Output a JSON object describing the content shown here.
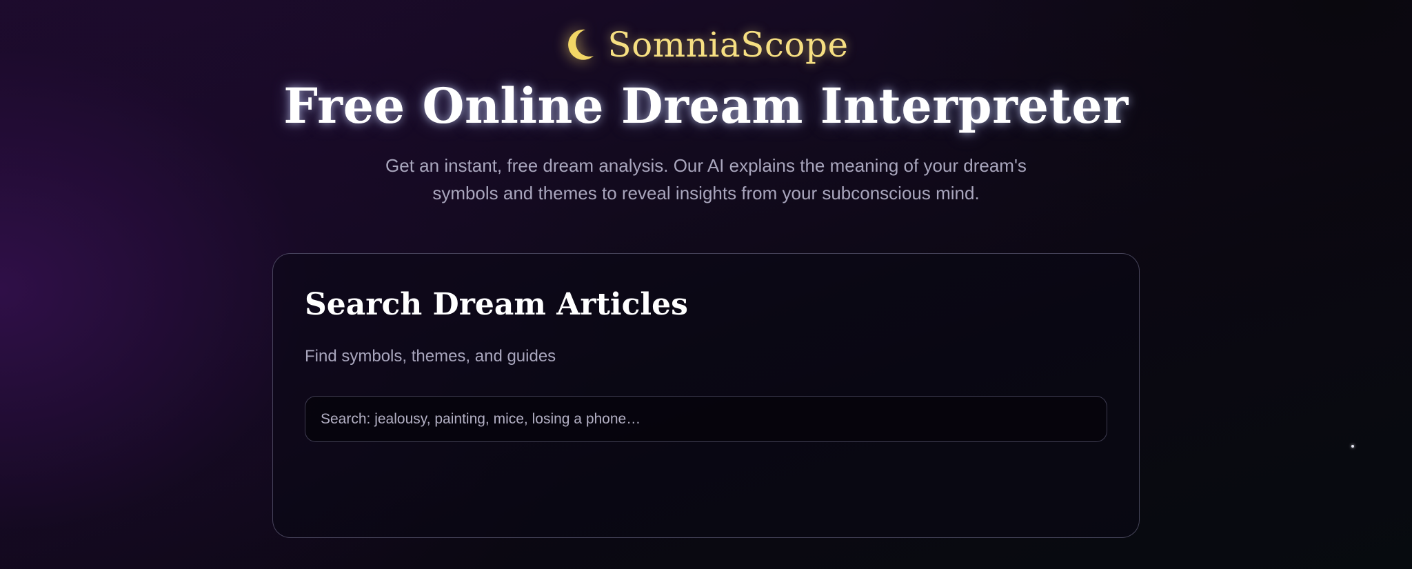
{
  "brand": {
    "name": "SomniaScope",
    "icon": "crescent-moon-icon",
    "color": "#f6df82"
  },
  "hero": {
    "title": "Free Online Dream Interpreter",
    "subtitle": "Get an instant, free dream analysis. Our AI explains the meaning of your dream's symbols and themes to reveal insights from your subconscious mind."
  },
  "search_card": {
    "title": "Search Dream Articles",
    "subtitle": "Find symbols, themes, and guides",
    "input": {
      "placeholder": "Search: jealousy, painting, mice, losing a phone…",
      "value": ""
    }
  },
  "colors": {
    "background_dark": "#0b0812",
    "background_purple": "#1d0b2c",
    "muted_text": "#a9a6bd",
    "accent_gold": "#f6df82"
  }
}
